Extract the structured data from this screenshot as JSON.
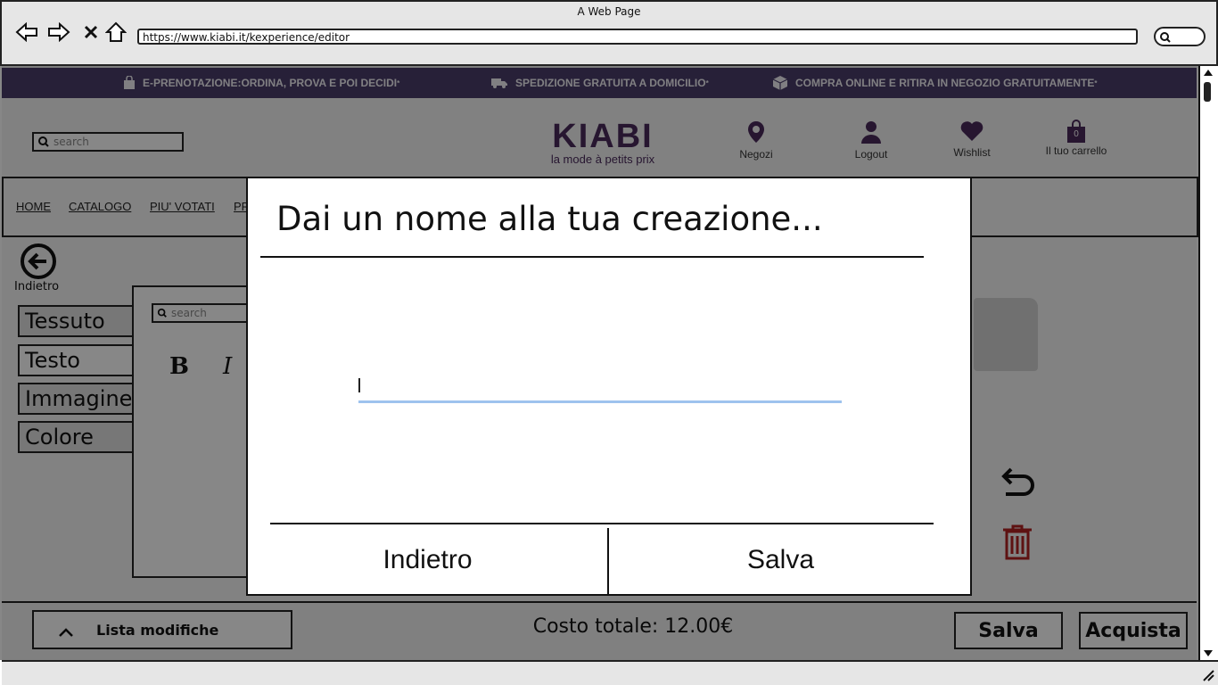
{
  "window": {
    "title": "A Web Page",
    "url": "https://www.kiabi.it/kexperience/editor"
  },
  "promo": [
    {
      "icon": "shopping-bag-icon",
      "text": "E-PRENOTAZIONE:ORDINA, PROVA E POI DECIDI",
      "mark": "*"
    },
    {
      "icon": "truck-icon",
      "text": "SPEDIZIONE GRATUITA A DOMICILIO",
      "mark": "*"
    },
    {
      "icon": "package-icon",
      "text": "COMPRA ONLINE E RITIRA IN NEGOZIO GRATUITAMENTE",
      "mark": "*"
    }
  ],
  "header": {
    "search_placeholder": "search",
    "logo_text": "KIABI",
    "logo_tagline": "la mode à petits prix",
    "links": [
      {
        "icon": "map-pin-icon",
        "label": "Negozi"
      },
      {
        "icon": "user-icon",
        "label": "Logout"
      },
      {
        "icon": "heart-icon",
        "label": "Wishlist"
      },
      {
        "icon": "cart-icon",
        "label": "Il tuo carrello",
        "count": "0"
      }
    ]
  },
  "nav": [
    "HOME",
    "CATALOGO",
    "PIU' VOTATI",
    "PR"
  ],
  "editor": {
    "back_label": "Indietro",
    "tabs": [
      "Tessuto",
      "Testo",
      "Immagine",
      "Colore"
    ],
    "panel_search_placeholder": "search",
    "format_buttons": [
      "B",
      "I"
    ]
  },
  "bottom": {
    "lista_label": "Lista modifiche",
    "costo_label": "Costo totale: 12.00€",
    "save_label": "Salva",
    "buy_label": "Acquista"
  },
  "modal": {
    "title": "Dai un nome alla tua creazione...",
    "input_value": "",
    "back_button": "Indietro",
    "save_button": "Salva"
  },
  "colors": {
    "promo_bg": "#4a3e6a",
    "brand": "#4a2a5c",
    "input_underline": "#9ec3ee",
    "trash": "#b22222"
  }
}
